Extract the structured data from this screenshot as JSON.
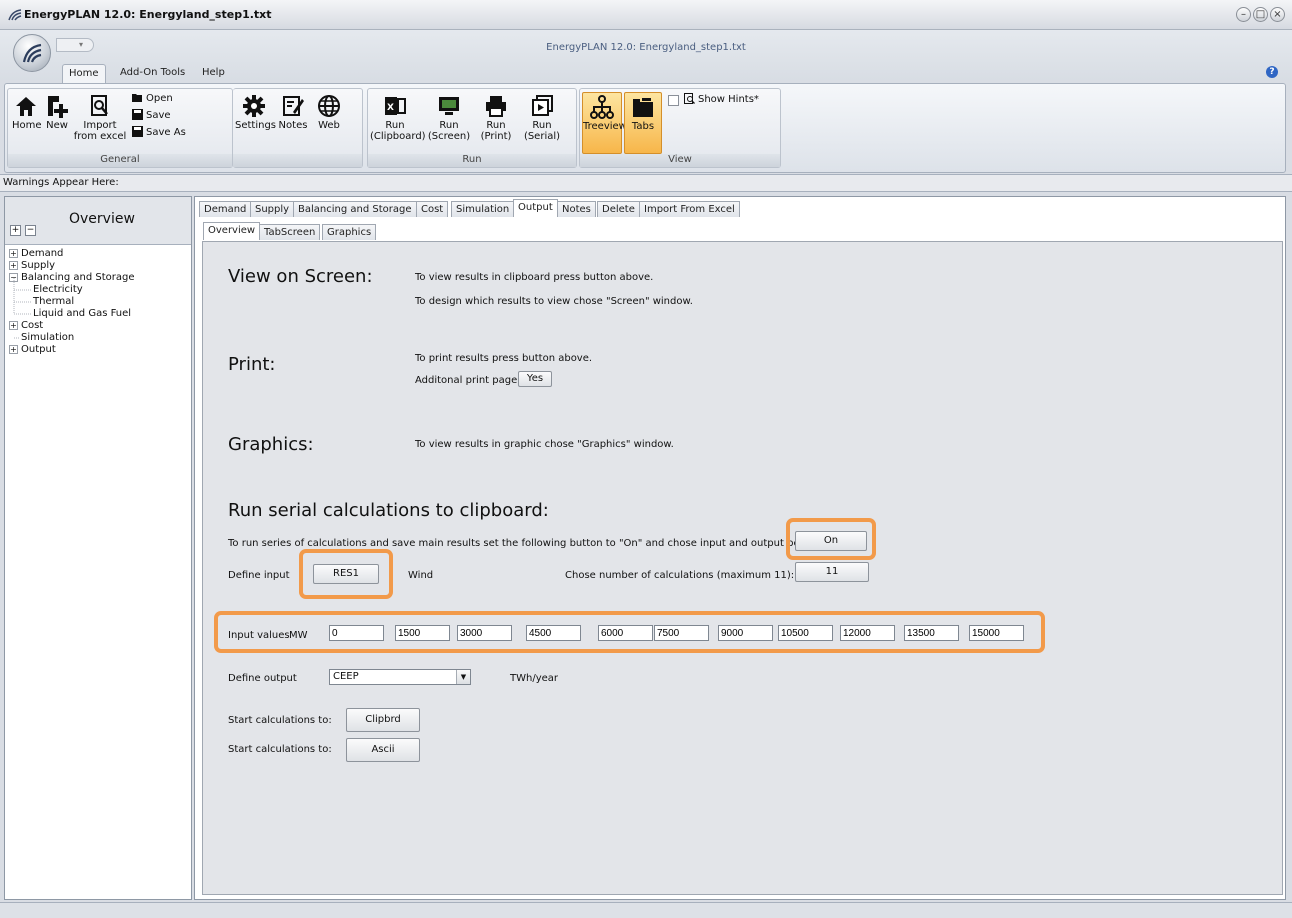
{
  "window": {
    "title": "EnergyPLAN 12.0: Energyland_step1.txt",
    "caption": "EnergyPLAN 12.0: Energyland_step1.txt",
    "min": "–",
    "max": "□",
    "close": "×"
  },
  "ribbon": {
    "tabs": [
      "Home",
      "Add-On Tools",
      "Help"
    ],
    "groups": {
      "general": {
        "label": "General",
        "home": "Home",
        "new": "New",
        "import": "Import",
        "import2": "from excel",
        "open": "Open",
        "save": "Save",
        "save_as": "Save As",
        "settings": "Settings",
        "notes": "Notes",
        "web": "Web"
      },
      "run": {
        "label": "Run",
        "clipboard": "Run",
        "clipboard2": "(Clipboard)",
        "screen": "Run",
        "screen2": "(Screen)",
        "print": "Run",
        "print2": "(Print)",
        "serial": "Run",
        "serial2": "(Serial)"
      },
      "view": {
        "label": "View",
        "treeview": "Treeview",
        "tabs": "Tabs",
        "show_hints": "Show Hints*"
      }
    }
  },
  "warnings": "Warnings Appear Here:",
  "overview": {
    "title": "Overview",
    "tree": [
      {
        "label": "Demand"
      },
      {
        "label": "Supply"
      },
      {
        "label": "Balancing and Storage"
      },
      {
        "label": "Electricity"
      },
      {
        "label": "Thermal"
      },
      {
        "label": "Liquid and Gas Fuel"
      },
      {
        "label": "Cost"
      },
      {
        "label": "Simulation"
      },
      {
        "label": "Output"
      }
    ]
  },
  "tabs_main": [
    "Demand",
    "Supply",
    "Balancing and Storage",
    "Cost",
    "Simulation",
    "Output",
    "Notes",
    "Delete",
    "Import From Excel"
  ],
  "tabs_sub": [
    "Overview",
    "TabScreen",
    "Graphics"
  ],
  "output": {
    "view_heading": "View on Screen:",
    "view_line1": "To view results in clipboard press button above.",
    "view_line2": "To design which results to view chose \"Screen\" window.",
    "print_heading": "Print:",
    "print_line1": "To print results press button above.",
    "print_line2": "Additonal print page:",
    "print_yes": "Yes",
    "graphics_heading": "Graphics:",
    "graphics_line": "To view results in graphic chose \"Graphics\" window.",
    "serial_heading": "Run serial calculations to clipboard:",
    "serial_line": "To run series of calculations and save main results set the following button to \"On\" and chose input and output below:",
    "serial_toggle": "On",
    "define_input": "Define input",
    "input_var": "RES1",
    "input_name": "Wind",
    "num_calcs_label": "Chose number of calculations (maximum 11):",
    "num_calcs": "11",
    "input_values_label": "Input values",
    "input_unit": "MW",
    "input_values": [
      "0",
      "1500",
      "3000",
      "4500",
      "6000",
      "7500",
      "9000",
      "10500",
      "12000",
      "13500",
      "15000"
    ],
    "define_output": "Define output",
    "output_var": "CEEP",
    "output_unit": "TWh/year",
    "start_label1": "Start calculations to:",
    "start_btn1": "Clipbrd",
    "start_label2": "Start calculations to:",
    "start_btn2": "Ascii"
  }
}
